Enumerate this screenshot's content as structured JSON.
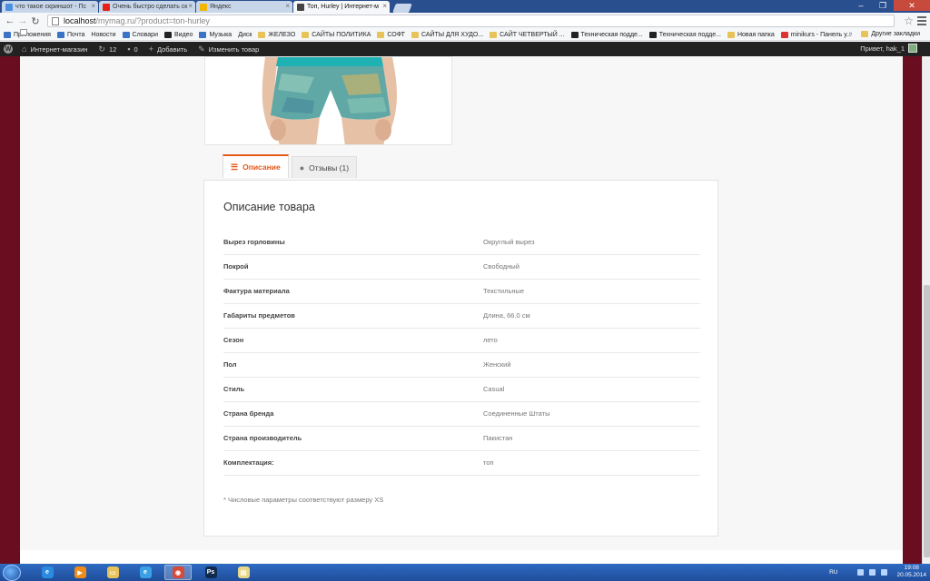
{
  "browser": {
    "tabs": [
      {
        "label": "что такое скриншот - Пс",
        "fav_color": "#4a90e2",
        "active": false
      },
      {
        "label": "Очень быстро сделать ск",
        "fav_color": "#e62117",
        "active": false
      },
      {
        "label": "Яндекс",
        "fav_color": "#f2b600",
        "active": false
      },
      {
        "label": "Топ, Hurley | Интернет-м",
        "fav_color": "#444444",
        "active": true
      }
    ],
    "url_host": "localhost",
    "url_rest": "/mymag.ru/?product=ton-hurley",
    "bookmarks": [
      {
        "label": "Приложения",
        "icon": "apps-icon",
        "kind": "blue"
      },
      {
        "label": "Почта",
        "icon": "mail-icon",
        "kind": "blue"
      },
      {
        "label": "Новости",
        "icon": "page-icon",
        "kind": "page"
      },
      {
        "label": "Словари",
        "icon": "book-icon",
        "kind": "blue"
      },
      {
        "label": "Видео",
        "icon": "video-icon",
        "kind": "dark"
      },
      {
        "label": "Музыка",
        "icon": "music-icon",
        "kind": "blue"
      },
      {
        "label": "Диск",
        "icon": "page-icon",
        "kind": "page"
      },
      {
        "label": "ЖЕЛЕЗО",
        "icon": "folder-icon",
        "kind": "folder"
      },
      {
        "label": "САЙТЫ ПОЛИТИКА",
        "icon": "folder-icon",
        "kind": "folder"
      },
      {
        "label": "СОФТ",
        "icon": "folder-icon",
        "kind": "folder"
      },
      {
        "label": "САЙТЫ ДЛЯ ХУДО...",
        "icon": "folder-icon",
        "kind": "folder"
      },
      {
        "label": "САЙТ ЧЕТВЕРТЫЙ ...",
        "icon": "folder-icon",
        "kind": "folder"
      },
      {
        "label": "Техническая подде...",
        "icon": "support-icon",
        "kind": "dark"
      },
      {
        "label": "Техническая подде...",
        "icon": "support-icon",
        "kind": "dark"
      },
      {
        "label": "Новая папка",
        "icon": "folder-icon",
        "kind": "folder"
      },
      {
        "label": "minikurs - Панель у...",
        "icon": "joomla-icon",
        "kind": "red"
      }
    ],
    "bookmarks_more": "»",
    "other_bookmarks": "Другие закладки"
  },
  "adminbar": {
    "site_name": "Интернет-магазин",
    "updates_count": "12",
    "comments_count": "0",
    "add_label": "Добавить",
    "edit_label": "Изменить товар",
    "greeting": "Привет, hak_1"
  },
  "product": {
    "tabs": [
      {
        "label": "Описание",
        "icon": "list-icon",
        "active": true
      },
      {
        "label": "Отзывы (1)",
        "icon": "comment-icon",
        "active": false
      }
    ],
    "title": "Описание товара",
    "specs": [
      {
        "key": "Вырез горловины",
        "value": "Округлый вырез"
      },
      {
        "key": "Покрой",
        "value": "Свободный"
      },
      {
        "key": "Фактура материала",
        "value": "Текстильные"
      },
      {
        "key": "Габариты предметов",
        "value": "Длина, 66.0 см"
      },
      {
        "key": "Сезон",
        "value": "лето"
      },
      {
        "key": "Пол",
        "value": "Женский"
      },
      {
        "key": "Стиль",
        "value": "Casual"
      },
      {
        "key": "Страна бренда",
        "value": "Соединенные Штаты"
      },
      {
        "key": "Страна производитель",
        "value": "Пакистан"
      },
      {
        "key": "Комплектация:",
        "value": "топ"
      }
    ],
    "footnote": "* Числовые параметры соответствуют размеру XS"
  },
  "taskbar": {
    "lang": "RU",
    "time": "19:08",
    "date": "20.05.2014",
    "apps": [
      {
        "name": "ie",
        "glyph": "e",
        "color": "#2a8be0",
        "active": false
      },
      {
        "name": "media-player",
        "glyph": "▶",
        "color": "#f08c1a",
        "active": false
      },
      {
        "name": "explorer",
        "glyph": "▭",
        "color": "#e8c35a",
        "active": false
      },
      {
        "name": "ie-alt",
        "glyph": "e",
        "color": "#3aa0e6",
        "active": false
      },
      {
        "name": "chrome",
        "glyph": "◉",
        "color": "#d64a3a",
        "active": true
      },
      {
        "name": "photoshop",
        "glyph": "Ps",
        "color": "#0f2a4f",
        "active": false
      },
      {
        "name": "notes",
        "glyph": "▤",
        "color": "#e8d88a",
        "active": false
      }
    ]
  },
  "colors": {
    "accent": "#e5581a",
    "site_background": "#6b0d21",
    "adminbar": "#222222"
  }
}
